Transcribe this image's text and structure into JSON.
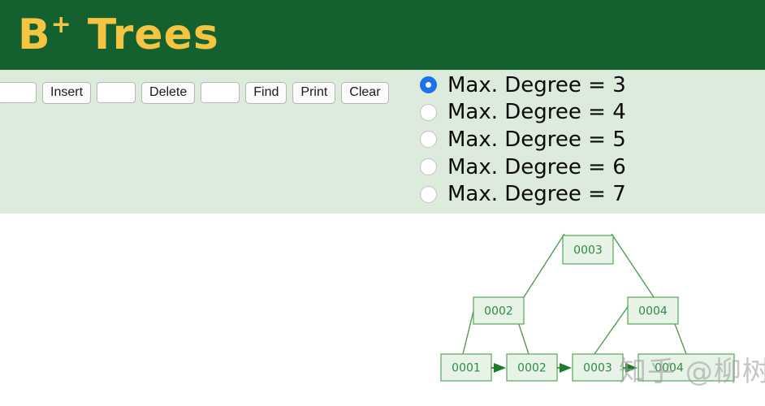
{
  "header": {
    "title_main": "B",
    "title_sup": "+",
    "title_rest": " Trees",
    "background_color": "#15602f",
    "title_color": "#f4c542"
  },
  "toolbar": {
    "background_color": "#dcebdc",
    "insert_value": "",
    "insert_placeholder": "",
    "insert_label": "Insert",
    "delete_value": "",
    "delete_placeholder": "",
    "delete_label": "Delete",
    "find_value": "",
    "find_placeholder": "",
    "find_label": "Find",
    "print_label": "Print",
    "clear_label": "Clear"
  },
  "degree_options": {
    "selected_index": 0,
    "accent_color": "#1a73e8",
    "items": [
      {
        "label": "Max. Degree = 3",
        "value": "3",
        "selected": true
      },
      {
        "label": "Max. Degree = 4",
        "value": "4",
        "selected": false
      },
      {
        "label": "Max. Degree = 5",
        "value": "5",
        "selected": false
      },
      {
        "label": "Max. Degree = 6",
        "value": "6",
        "selected": false
      },
      {
        "label": "Max. Degree = 7",
        "value": "7",
        "selected": false
      }
    ]
  },
  "tree": {
    "node_fill": "#e8f3e8",
    "node_stroke": "#57a657",
    "node_text_color": "#2e8b45",
    "edge_color": "#4f9c57",
    "link_color": "#2f8c3f",
    "root": {
      "key": "0003"
    },
    "internal": [
      {
        "key": "0002"
      },
      {
        "key": "0004"
      }
    ],
    "leaves": [
      {
        "key": "0001"
      },
      {
        "key": "0002"
      },
      {
        "key": "0003"
      },
      {
        "key": "0004"
      }
    ]
  },
  "watermark": {
    "text": "知乎 @柳树",
    "color": "#9f9f9f"
  }
}
